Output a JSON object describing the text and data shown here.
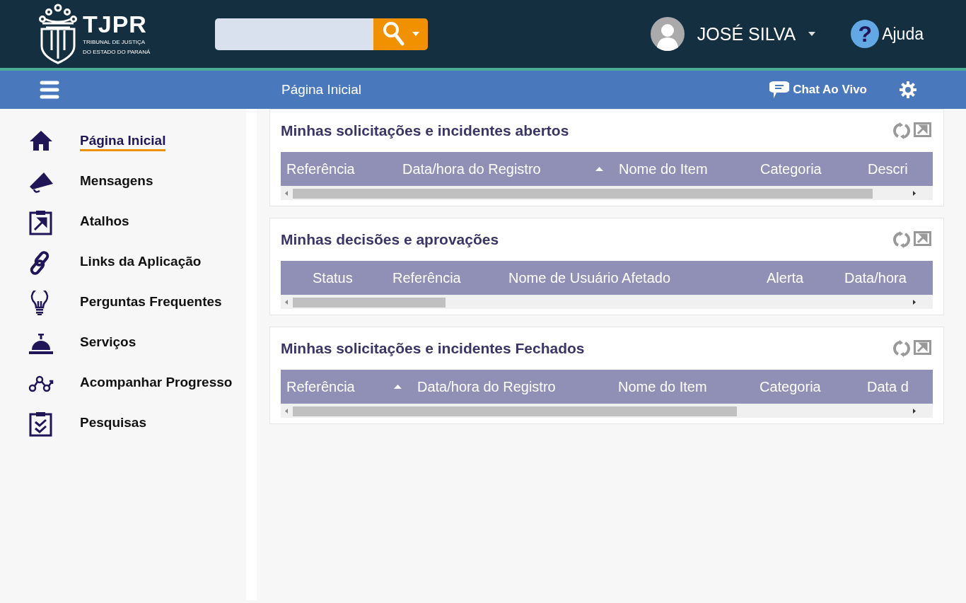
{
  "header": {
    "logo": {
      "name": "TJPR",
      "subtitle_lines": [
        "TRIBUNAL DE JUSTIÇA",
        "DO ESTADO DO PARANÁ"
      ]
    },
    "user": {
      "name": "JOSÉ SILVA"
    },
    "help": {
      "label": "Ajuda",
      "icon_char": "?"
    }
  },
  "navbar": {
    "title": "Página Inicial",
    "chat": "Chat Ao Vivo"
  },
  "sidebar": {
    "items": [
      {
        "label": "Página Inicial",
        "selected": true
      },
      {
        "label": "Mensagens",
        "selected": false
      },
      {
        "label": "Atalhos",
        "selected": false
      },
      {
        "label": "Links da Aplicação",
        "selected": false
      },
      {
        "label": "Perguntas Frequentes",
        "selected": false
      },
      {
        "label": "Serviços",
        "selected": false
      },
      {
        "label": "Acompanhar Progresso",
        "selected": false
      },
      {
        "label": "Pesquisas",
        "selected": false
      }
    ]
  },
  "widgets": [
    {
      "title": "Minhas solicitações e incidentes abertos",
      "columns": [
        {
          "label": "Referência",
          "sorted": false
        },
        {
          "label": "Data/hora do Registro",
          "sorted": true
        },
        {
          "label": "Nome do Item",
          "sorted": false
        },
        {
          "label": "Categoria",
          "sorted": false
        },
        {
          "label": "Descri",
          "sorted": false
        }
      ]
    },
    {
      "title": "Minhas decisões e aprovações",
      "columns": [
        {
          "label": "Status",
          "sorted": false
        },
        {
          "label": "Referência",
          "sorted": false
        },
        {
          "label": "Nome de Usuário Afetado",
          "sorted": false
        },
        {
          "label": "Alerta",
          "sorted": false
        },
        {
          "label": "Data/hora",
          "sorted": false
        }
      ]
    },
    {
      "title": "Minhas solicitações e incidentes Fechados",
      "columns": [
        {
          "label": "Referência",
          "sorted": true
        },
        {
          "label": "Data/hora do Registro",
          "sorted": false
        },
        {
          "label": "Nome do Item",
          "sorted": false
        },
        {
          "label": "Categoria",
          "sorted": false
        },
        {
          "label": "Data d",
          "sorted": false
        }
      ]
    }
  ]
}
